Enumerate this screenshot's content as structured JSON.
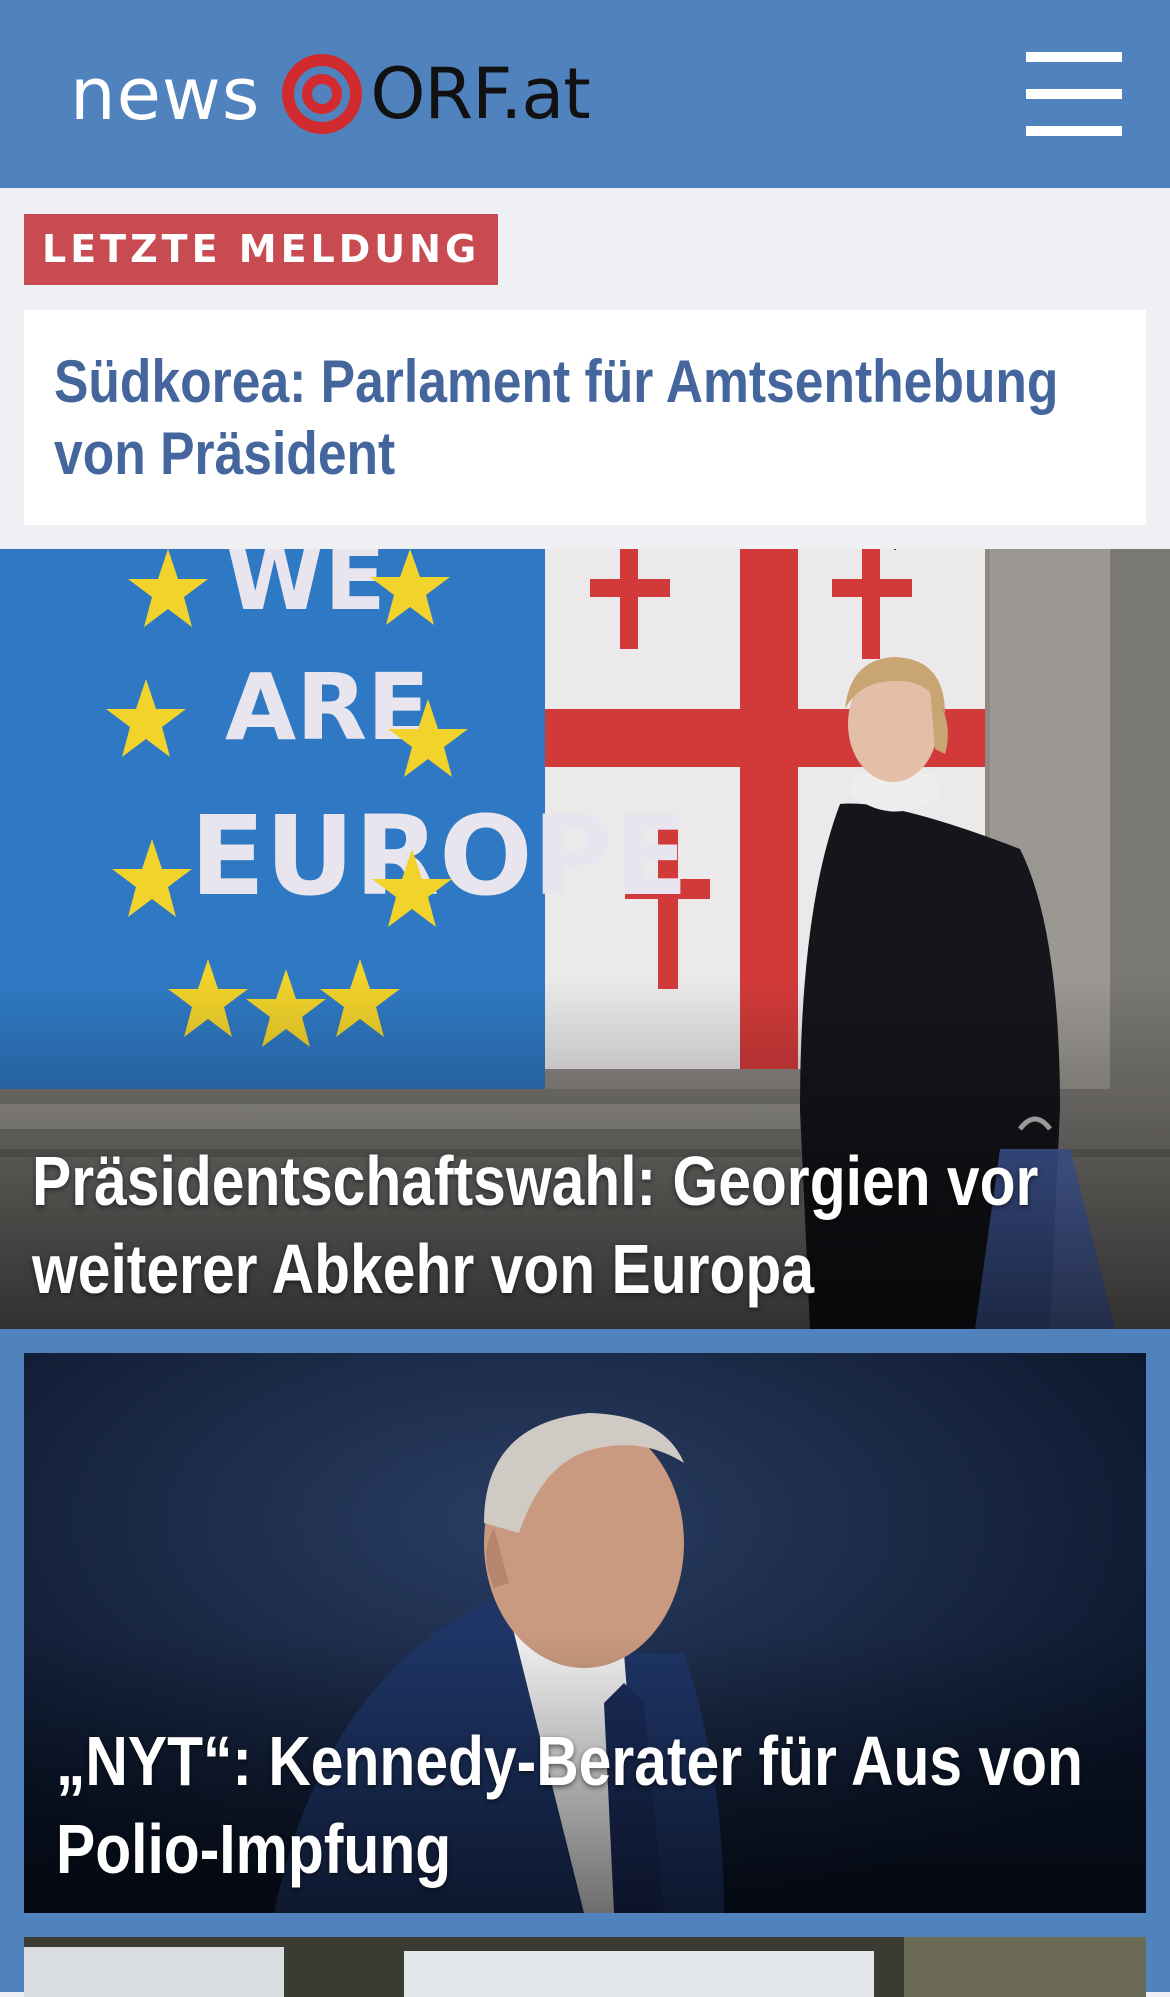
{
  "header": {
    "logo_text_news": "news",
    "logo_text_orf": "ORF.at",
    "menu_icon": "hamburger-menu-icon",
    "background": "#5083bd"
  },
  "breaking": {
    "badge_label": "LETZTE MELDUNG",
    "badge_color": "#c84b52",
    "headline": "Südkorea: Parlament für Amtsenthebung von Präsident",
    "headline_color": "#44669c"
  },
  "stories": [
    {
      "headline": "Präsidentschaftswahl: Georgien vor weiterer Abkehr von Europa",
      "image_mural_text": [
        "WE",
        "ARE",
        "EUROPE"
      ]
    },
    {
      "headline": "„NYT“: Kennedy-Berater für Aus von Polio-Impfung"
    }
  ]
}
